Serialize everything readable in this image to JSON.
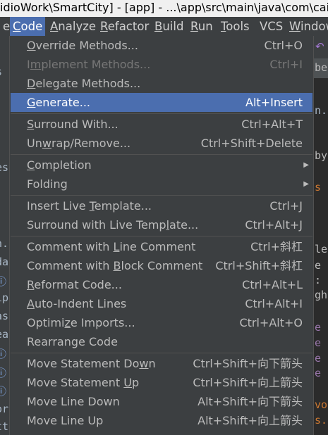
{
  "window": {
    "title": "idioWork\\SmartCity] - [app] - ...\\app\\src\\main\\java\\com\\caibao\\sr"
  },
  "menubar": {
    "items": [
      {
        "label": "e",
        "active": false
      },
      {
        "label": "Code",
        "active": true
      },
      {
        "label": "Analyze",
        "active": false
      },
      {
        "label": "Refactor",
        "active": false
      },
      {
        "label": "Build",
        "active": false
      },
      {
        "label": "Run",
        "active": false
      },
      {
        "label": "Tools",
        "active": false
      },
      {
        "label": "VCS",
        "active": false
      },
      {
        "label": "Window",
        "active": false
      }
    ]
  },
  "background": {
    "left_fragments": [
      "s",
      "es",
      "n.c",
      "da",
      "ⓘ ti",
      "ip",
      "as",
      "ea",
      "ⓘ t",
      "ⓘ i",
      "ⓘ t",
      "or",
      "tt"
    ],
    "right_fragments": [
      "bea",
      "n.c",
      "by",
      "s",
      "ler",
      "e :",
      ":",
      "ght",
      "e S",
      "e S",
      "e i",
      "e S",
      "vo",
      "s."
    ]
  },
  "code_menu": {
    "items": [
      {
        "label": "Override Methods...",
        "shortcut": "Ctrl+O",
        "mnemonic": 0
      },
      {
        "label": "Implement Methods...",
        "shortcut": "Ctrl+I",
        "disabled": true,
        "mnemonic": 1
      },
      {
        "label": "Delegate Methods...",
        "shortcut": "",
        "mnemonic": 0
      },
      {
        "label": "Generate...",
        "shortcut": "Alt+Insert",
        "selected": true,
        "mnemonic": 0
      },
      {
        "separator": true
      },
      {
        "label": "Surround With...",
        "shortcut": "Ctrl+Alt+T",
        "mnemonic": 0
      },
      {
        "label": "Unwrap/Remove...",
        "shortcut": "Ctrl+Shift+Delete",
        "mnemonic": 2
      },
      {
        "separator": true
      },
      {
        "label": "Completion",
        "shortcut": "",
        "submenu": true,
        "mnemonic": 0
      },
      {
        "label": "Folding",
        "shortcut": "",
        "submenu": true,
        "mnemonic": -1
      },
      {
        "separator": true
      },
      {
        "label": "Insert Live Template...",
        "shortcut": "Ctrl+J",
        "mnemonic": 12
      },
      {
        "label": "Surround with Live Template...",
        "shortcut": "Ctrl+Alt+J",
        "mnemonic": 23
      },
      {
        "separator": true
      },
      {
        "label": "Comment with Line Comment",
        "shortcut": "Ctrl+斜杠",
        "mnemonic": 13
      },
      {
        "label": "Comment with Block Comment",
        "shortcut": "Ctrl+Shift+斜杠",
        "mnemonic": 13
      },
      {
        "label": "Reformat Code...",
        "shortcut": "Ctrl+Alt+L",
        "mnemonic": 0
      },
      {
        "label": "Auto-Indent Lines",
        "shortcut": "Ctrl+Alt+I",
        "mnemonic": 0
      },
      {
        "label": "Optimize Imports...",
        "shortcut": "Ctrl+Alt+O",
        "mnemonic": 6
      },
      {
        "label": "Rearrange Code",
        "shortcut": "",
        "mnemonic": -1
      },
      {
        "separator": true
      },
      {
        "label": "Move Statement Down",
        "shortcut": "Ctrl+Shift+向下箭头",
        "mnemonic": 17
      },
      {
        "label": "Move Statement Up",
        "shortcut": "Ctrl+Shift+向上箭头",
        "mnemonic": 15
      },
      {
        "label": "Move Line Down",
        "shortcut": "Alt+Shift+向下箭头",
        "mnemonic": -1
      },
      {
        "label": "Move Line Up",
        "shortcut": "Alt+Shift+向上箭头",
        "mnemonic": -1
      }
    ]
  },
  "colors": {
    "menu_bg": "#3c3f41",
    "selection": "#4b6eaf",
    "text": "#bbbbbb",
    "disabled_text": "#777777"
  }
}
